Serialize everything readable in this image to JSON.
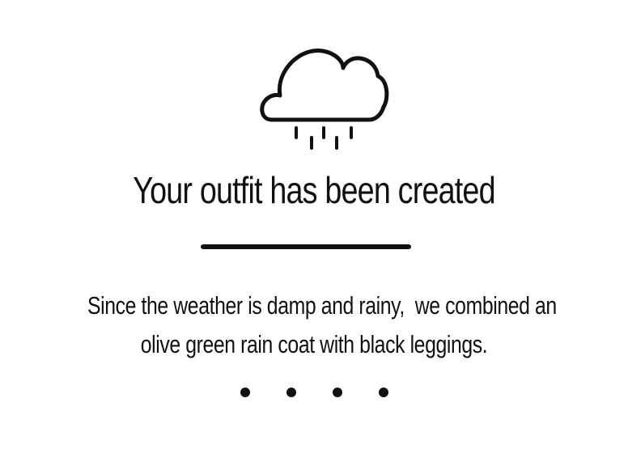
{
  "screen": {
    "icon": "rain-cloud-icon",
    "title": "Your outfit has been created",
    "message_line1": "Since the weather is damp and rainy,  we combined an",
    "message_line2": "olive green rain coat with black leggings.",
    "pager_dot_count": 4
  },
  "colors": {
    "foreground": "#111111",
    "background": "#ffffff"
  }
}
